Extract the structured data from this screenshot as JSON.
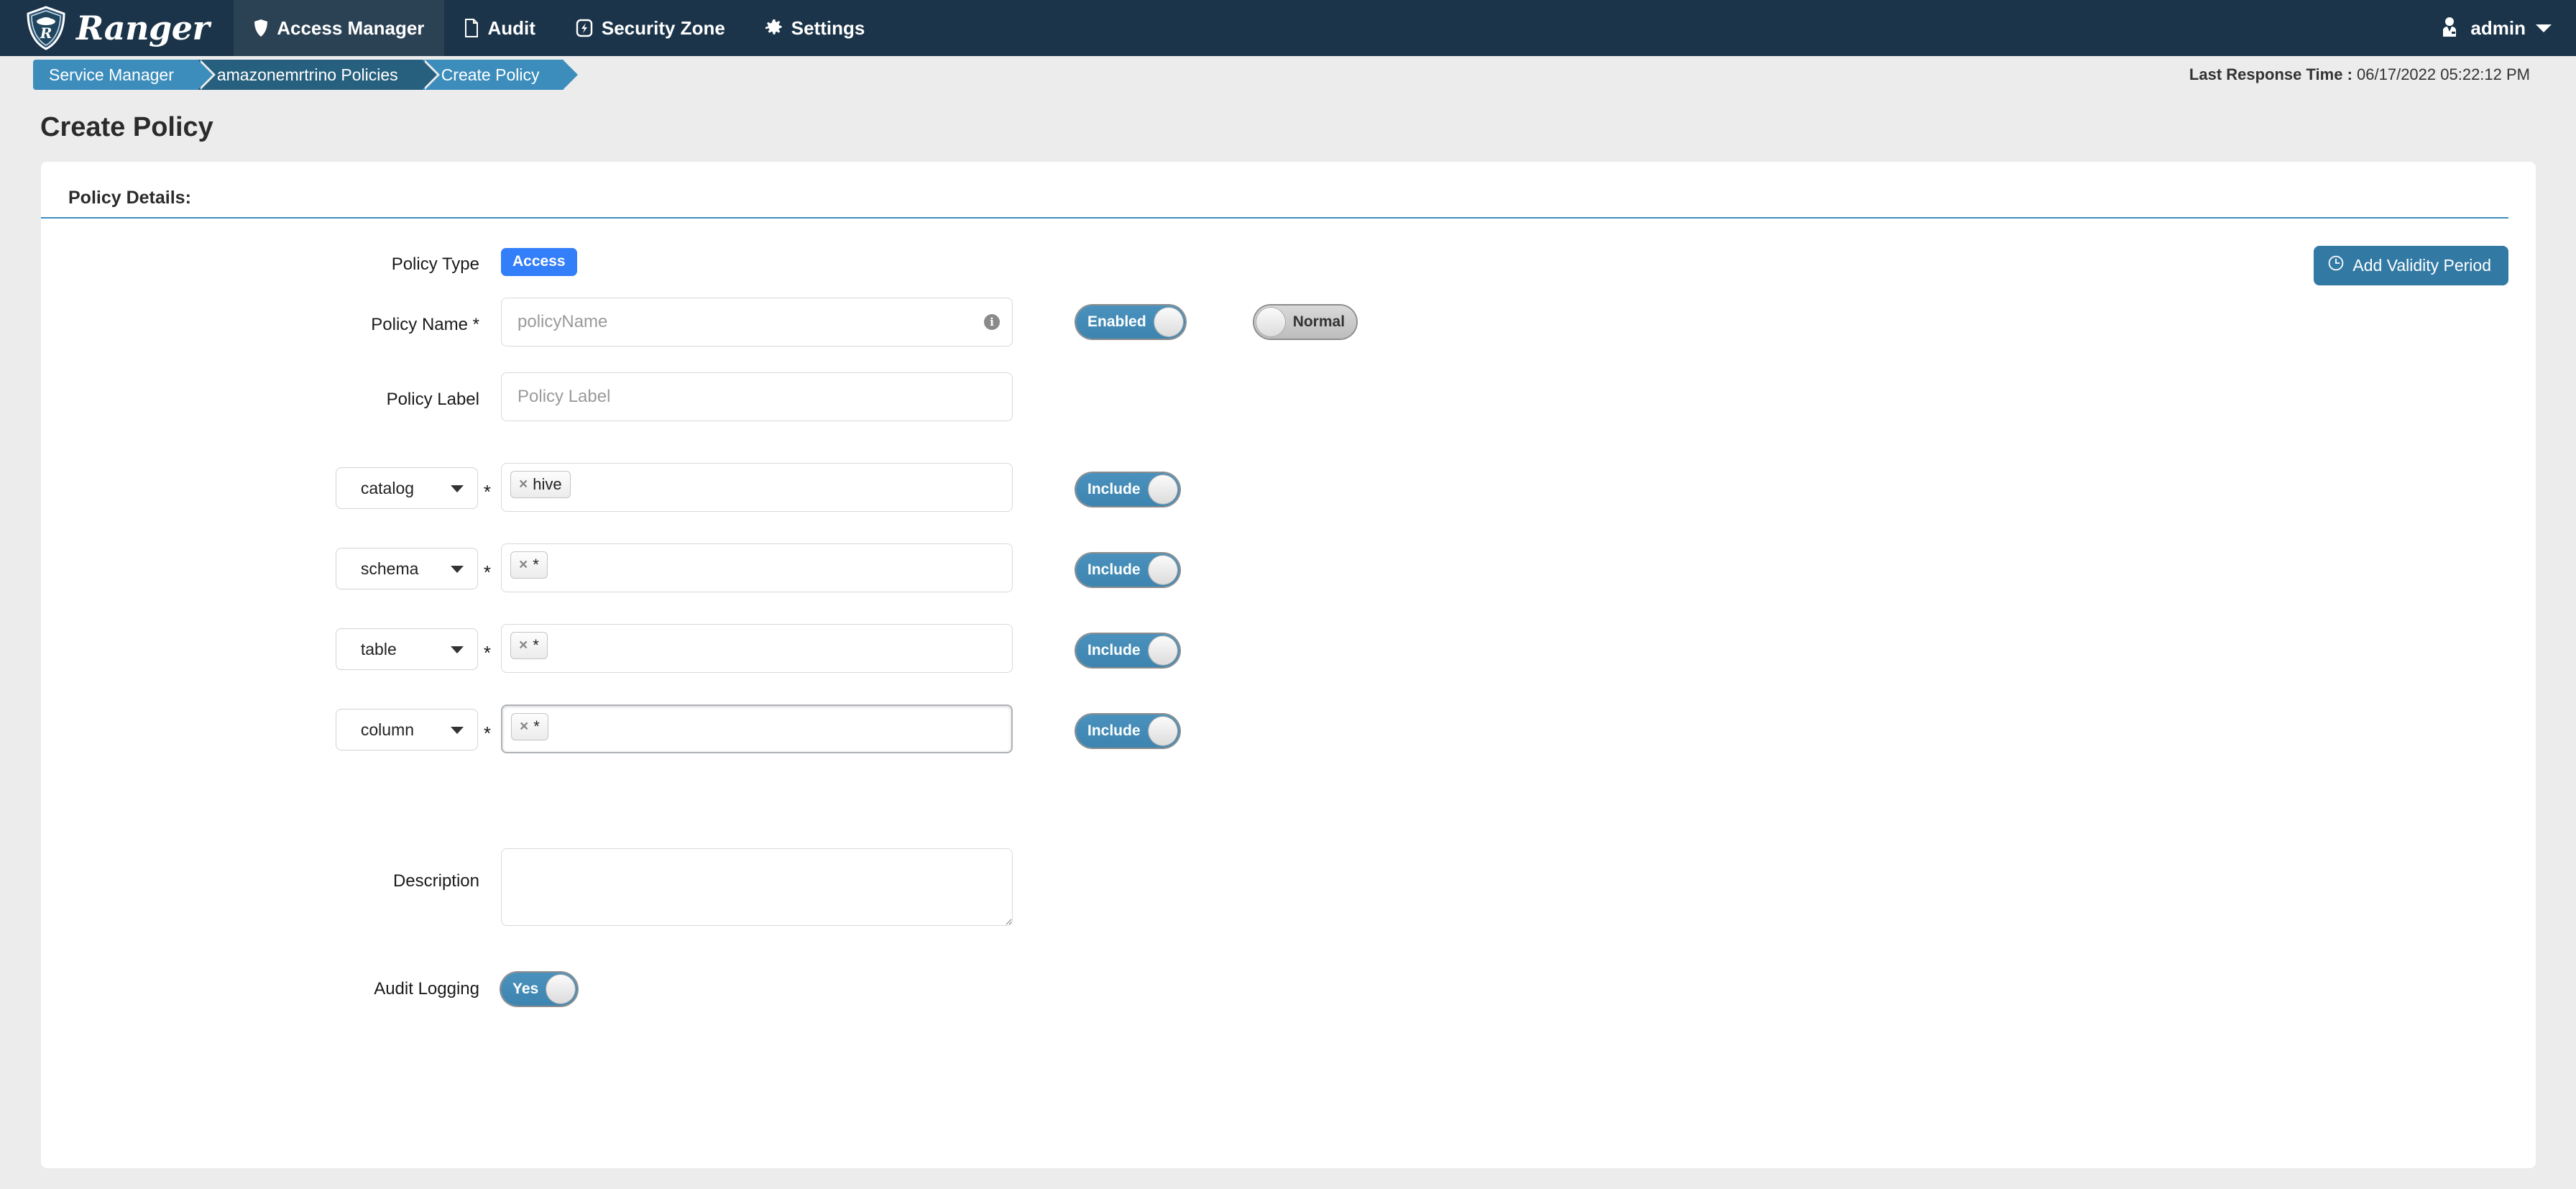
{
  "navbar": {
    "brand": "Ranger",
    "brand_logo_icon": "ranger-shield-logo",
    "items": [
      {
        "label": "Access Manager",
        "icon": "shield-icon",
        "active": true
      },
      {
        "label": "Audit",
        "icon": "document-icon",
        "active": false
      },
      {
        "label": "Security Zone",
        "icon": "bolt-square-icon",
        "active": false
      },
      {
        "label": "Settings",
        "icon": "gear-icon",
        "active": false
      }
    ],
    "user": {
      "name": "admin",
      "icon": "user-tie-icon",
      "caret": "chevron-down-icon"
    }
  },
  "breadcrumb": {
    "items": [
      {
        "label": "Service Manager",
        "style": "light"
      },
      {
        "label": "amazonemrtrino Policies",
        "style": "dark"
      },
      {
        "label": "Create Policy",
        "style": "light"
      }
    ],
    "last_response_label": "Last Response Time :",
    "last_response_value": "06/17/2022 05:22:12 PM"
  },
  "page": {
    "title": "Create Policy",
    "section_title": "Policy Details:"
  },
  "form": {
    "policy_type": {
      "label": "Policy Type",
      "badge": "Access"
    },
    "add_validity_button": {
      "label": "Add Validity Period",
      "icon": "clock-icon"
    },
    "policy_name": {
      "label": "Policy Name *",
      "placeholder": "policyName",
      "value": "",
      "info_icon": "info-circle-icon"
    },
    "status_toggle": {
      "label": "Enabled",
      "state": "on"
    },
    "priority_toggle": {
      "label": "Normal",
      "state": "off"
    },
    "policy_label": {
      "label": "Policy Label",
      "placeholder": "Policy Label",
      "value": ""
    },
    "resources": [
      {
        "select_value": "catalog",
        "required": "*",
        "chips": [
          {
            "label": "hive",
            "remove": "×"
          }
        ],
        "toggle": {
          "label": "Include",
          "state": "on"
        },
        "focused": false
      },
      {
        "select_value": "schema",
        "required": "*",
        "chips": [
          {
            "label": "*",
            "remove": "×"
          }
        ],
        "toggle": {
          "label": "Include",
          "state": "on"
        },
        "focused": false
      },
      {
        "select_value": "table",
        "required": "*",
        "chips": [
          {
            "label": "*",
            "remove": "×"
          }
        ],
        "toggle": {
          "label": "Include",
          "state": "on"
        },
        "focused": false
      },
      {
        "select_value": "column",
        "required": "*",
        "chips": [
          {
            "label": "*",
            "remove": "×"
          }
        ],
        "toggle": {
          "label": "Include",
          "state": "on"
        },
        "focused": true
      }
    ],
    "description": {
      "label": "Description",
      "placeholder": "",
      "value": ""
    },
    "audit_logging": {
      "label": "Audit Logging",
      "toggle": {
        "label": "Yes",
        "state": "on"
      }
    }
  },
  "colors": {
    "navbar_bg": "#1b3449",
    "crumb_light": "#3c8dbc",
    "crumb_dark": "#27607f",
    "accent_blue": "#3c8dbc",
    "badge_blue": "#337ef9",
    "button_blue": "#3279a3",
    "page_bg": "#ececec"
  }
}
